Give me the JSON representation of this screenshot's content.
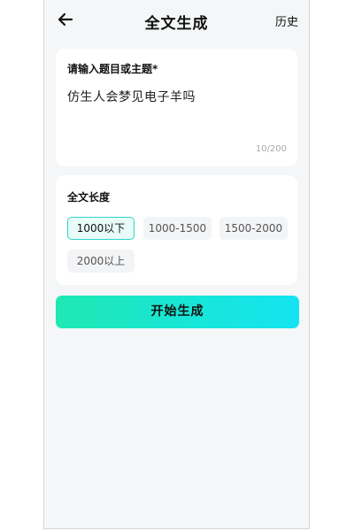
{
  "header": {
    "title": "全文生成",
    "history_label": "历史",
    "back_icon": "arrow-left-icon"
  },
  "topic": {
    "label": "请输入题目或主题*",
    "value": "仿生人会梦见电子羊吗",
    "counter": "10/200"
  },
  "length": {
    "label": "全文长度",
    "options": [
      "1000以下",
      "1000-1500",
      "1500-2000",
      "2000以上"
    ],
    "selected": "1000以下"
  },
  "actions": {
    "start_label": "开始生成"
  },
  "colors": {
    "accent_start": "#1fe8b2",
    "accent_end": "#14e4f1",
    "selected_border": "#2fd5c7",
    "selected_bg": "#e7fbf8",
    "background": "#f4f6f8"
  }
}
